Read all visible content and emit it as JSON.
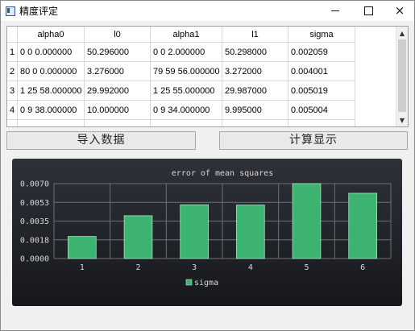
{
  "window": {
    "title": "精度评定",
    "minimize_glyph": "minimize-icon",
    "maximize_glyph": "maximize-icon",
    "close_glyph": "×"
  },
  "table": {
    "columns": [
      "alpha0",
      "l0",
      "alpha1",
      "l1",
      "sigma"
    ],
    "rows": [
      {
        "index": "1",
        "cells": [
          "0 0 0.000000",
          "50.296000",
          "0 0 2.000000",
          "50.298000",
          "0.002059"
        ]
      },
      {
        "index": "2",
        "cells": [
          "80 0 0.000000",
          "3.276000",
          "79 59 56.000000",
          "3.272000",
          "0.004001"
        ]
      },
      {
        "index": "3",
        "cells": [
          "1 25 58.000000",
          "29.992000",
          "1 25 55.000000",
          "29.987000",
          "0.005019"
        ]
      },
      {
        "index": "4",
        "cells": [
          "0 9 38.000000",
          "10.000000",
          "0 9 34.000000",
          "9.995000",
          "0.005004"
        ]
      }
    ]
  },
  "buttons": {
    "import_label": "导入数据",
    "compute_label": "计算显示"
  },
  "chart_data": {
    "type": "bar",
    "title": "error of mean squares",
    "categories": [
      "1",
      "2",
      "3",
      "4",
      "5",
      "6"
    ],
    "series": [
      {
        "name": "sigma",
        "values": [
          0.00206,
          0.004,
          0.00502,
          0.005,
          0.007,
          0.0061
        ],
        "color": "#3cb371"
      }
    ],
    "yticks": [
      "0.0000",
      "0.0018",
      "0.0035",
      "0.0053",
      "0.0070"
    ],
    "ylim": [
      0,
      0.007
    ],
    "grid": true,
    "legend": "bottom-center",
    "xlabel": "",
    "ylabel": ""
  }
}
